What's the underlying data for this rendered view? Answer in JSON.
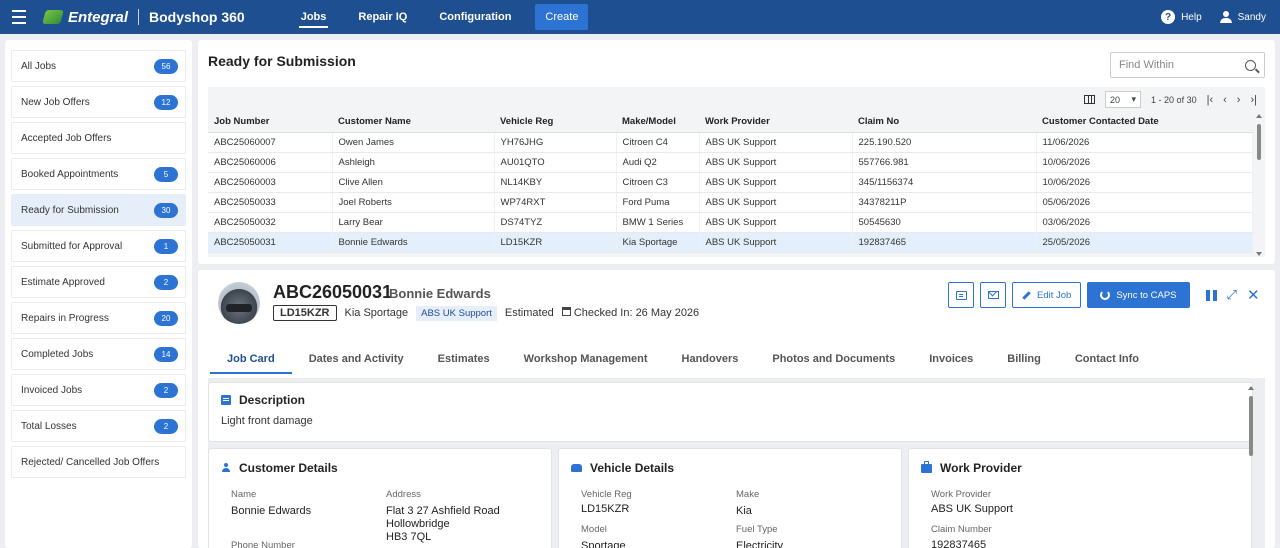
{
  "topbar": {
    "brand": "Entegral",
    "app_name": "Bodyshop 360",
    "nav": [
      "Jobs",
      "Repair IQ",
      "Configuration"
    ],
    "create_label": "Create",
    "help_label": "Help",
    "user_label": "Sandy"
  },
  "sidebar": {
    "items": [
      {
        "label": "All Jobs",
        "count": "56"
      },
      {
        "label": "New Job Offers",
        "count": "12"
      },
      {
        "label": "Accepted Job Offers",
        "count": ""
      },
      {
        "label": "Booked Appointments",
        "count": "5"
      },
      {
        "label": "Ready for Submission",
        "count": "30"
      },
      {
        "label": "Submitted for Approval",
        "count": "1"
      },
      {
        "label": "Estimate Approved",
        "count": "2"
      },
      {
        "label": "Repairs in Progress",
        "count": "20"
      },
      {
        "label": "Completed Jobs",
        "count": "14"
      },
      {
        "label": "Invoiced Jobs",
        "count": "2"
      },
      {
        "label": "Total Losses",
        "count": "2"
      },
      {
        "label": "Rejected/ Cancelled Job Offers",
        "count": ""
      }
    ]
  },
  "ready": {
    "title": "Ready for Submission",
    "find_placeholder": "Find Within",
    "page_size": "20",
    "page_range": "1 - 20 of 30",
    "columns": [
      "Job Number",
      "Customer Name",
      "Vehicle Reg",
      "Make/Model",
      "Work Provider",
      "Claim No",
      "Customer Contacted Date"
    ],
    "rows": [
      [
        "ABC25060007",
        "Owen James",
        "YH76JHG",
        "Citroen C4",
        "ABS UK Support",
        "225.190.520",
        "11/06/2026"
      ],
      [
        "ABC25060006",
        "Ashleigh",
        "AU01QTO",
        "Audi Q2",
        "ABS UK Support",
        "557766.981",
        "10/06/2026"
      ],
      [
        "ABC25060003",
        "Clive Allen",
        "NL14KBY",
        "Citroen C3",
        "ABS UK Support",
        "345/1156374",
        "10/06/2026"
      ],
      [
        "ABC25050033",
        "Joel Roberts",
        "WP74RXT",
        "Ford Puma",
        "ABS UK Support",
        "34378211P",
        "05/06/2026"
      ],
      [
        "ABC25050032",
        "Larry Bear",
        "DS74TYZ",
        "BMW 1 Series",
        "ABS UK Support",
        "50545630",
        "03/06/2026"
      ],
      [
        "ABC25050031",
        "Bonnie Edwards",
        "LD15KZR",
        "Kia Sportage",
        "ABS UK Support",
        "192837465",
        "25/05/2026"
      ]
    ]
  },
  "job": {
    "number": "ABC26050031",
    "customer": "Bonnie Edwards",
    "reg": "LD15KZR",
    "model": "Kia Sportage",
    "provider_tag": "ABS UK Support",
    "status": "Estimated",
    "checked_in": "Checked In: 26 May 2026",
    "edit_label": "Edit Job",
    "sync_label": "Sync to CAPS",
    "tabs": [
      "Job Card",
      "Dates and Activity",
      "Estimates",
      "Workshop Management",
      "Handovers",
      "Photos and Documents",
      "Invoices",
      "Billing",
      "Contact Info"
    ],
    "description_title": "Description",
    "description_text": "Light front damage",
    "customer_card": {
      "title": "Customer Details",
      "name_label": "Name",
      "name": "Bonnie Edwards",
      "address_label": "Address",
      "address_line1": "Flat 3 27 Ashfield Road",
      "address_line2": "Hollowbridge",
      "address_line3": "HB3 7QL",
      "phone_label": "Phone Number"
    },
    "vehicle_card": {
      "title": "Vehicle Details",
      "reg_label": "Vehicle Reg",
      "reg": "LD15KZR",
      "make_label": "Make",
      "make": "Kia",
      "model_label": "Model",
      "model": "Sportage",
      "fuel_label": "Fuel Type",
      "fuel": "Electricity"
    },
    "provider_card": {
      "title": "Work Provider",
      "provider_label": "Work Provider",
      "provider": "ABS UK Support",
      "claim_label": "Claim Number",
      "claim": "192837465"
    }
  },
  "colors": {
    "topbar": "#1d4f91",
    "accent": "#2d73d4",
    "selected_row": "#e3effb"
  }
}
